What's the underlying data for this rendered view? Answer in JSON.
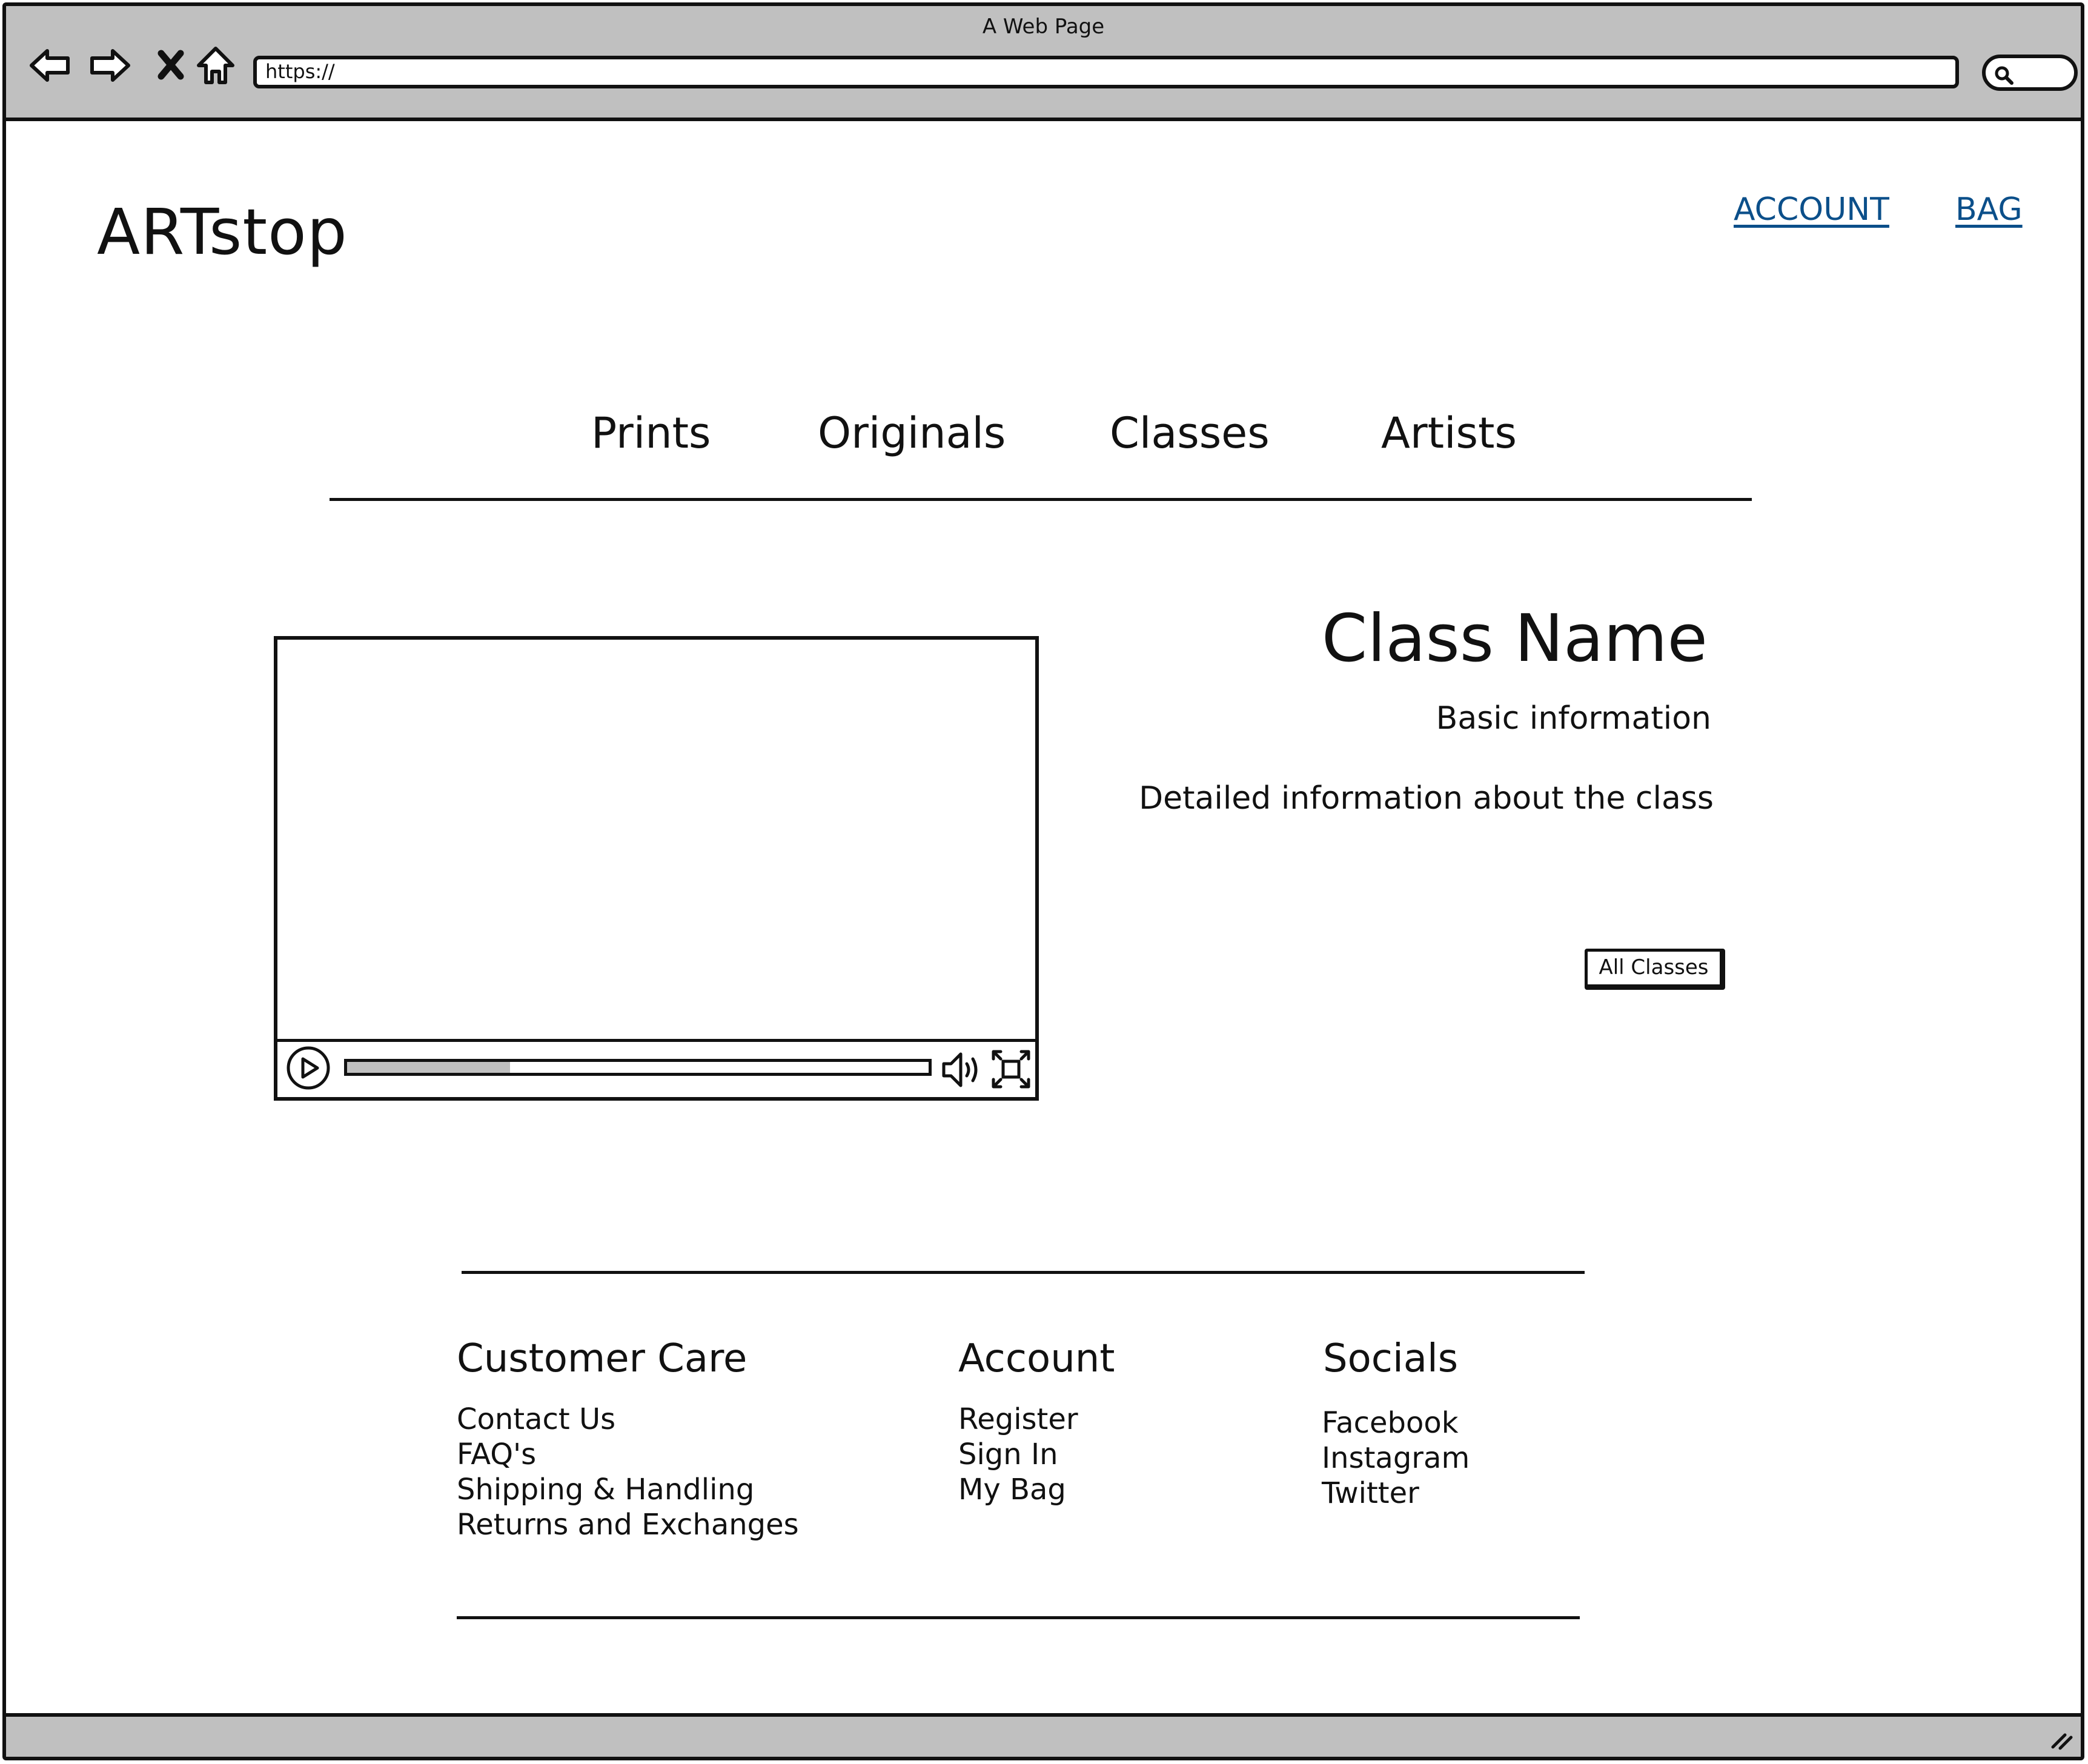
{
  "browser": {
    "window_title": "A Web Page",
    "url": "https://"
  },
  "header": {
    "logo": "ARTstop",
    "links": [
      "ACCOUNT",
      "BAG"
    ],
    "link_color": "#0b4f8a"
  },
  "nav": {
    "items": [
      "Prints",
      "Originals",
      "Classes",
      "Artists"
    ]
  },
  "video": {
    "progress": 0.28
  },
  "class": {
    "name": "Class Name",
    "basic_info": "Basic information",
    "detail_info": "Detailed information about the class",
    "all_classes_button": "All Classes"
  },
  "footer": {
    "columns": [
      {
        "heading": "Customer Care",
        "items": [
          "Contact Us",
          "FAQ's",
          "Shipping & Handling",
          "Returns and Exchanges"
        ]
      },
      {
        "heading": "Account",
        "items": [
          "Register",
          "Sign In",
          "My Bag"
        ]
      },
      {
        "heading": "Socials",
        "items": [
          "Facebook",
          "Instagram",
          "Twitter"
        ]
      }
    ]
  },
  "icons": {
    "back": "back-arrow-icon",
    "forward": "forward-arrow-icon",
    "stop": "stop-x-icon",
    "home": "home-icon",
    "search": "search-icon",
    "play": "play-icon",
    "volume": "volume-icon",
    "fullscreen": "fullscreen-icon",
    "resize": "resize-grip-icon"
  },
  "colors": {
    "chrome": "#c0c0c0",
    "ink": "#111111",
    "link": "#0b4f8a"
  }
}
